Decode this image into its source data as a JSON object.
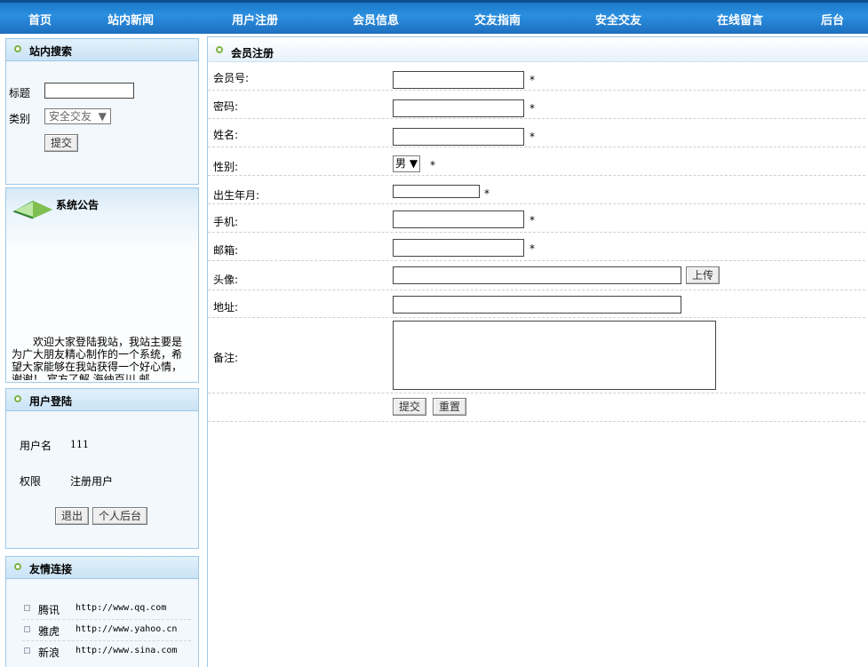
{
  "nav": [
    "首页",
    "站内新闻",
    "用户注册",
    "会员信息",
    "交友指南",
    "安全交友",
    "在线留言",
    "后台"
  ],
  "search": {
    "title": "站内搜索",
    "title_label": "标题",
    "category_label": "类别",
    "category_selected": "安全交友",
    "submit": "提交"
  },
  "notice": {
    "title": "系统公告",
    "text": "欢迎大家登陆我站，我站主要是为广大朋友精心制作的一个系统，希望大家能够在我站获得一个好心情，谢谢！ 官方了解 海纳百川 邮"
  },
  "login": {
    "title": "用户登陆",
    "username_label": "用户名",
    "username_value": "111",
    "role_label": "权限",
    "role_value": "注册用户",
    "logout": "退出",
    "backend": "个人后台"
  },
  "links": {
    "title": "友情连接",
    "items": [
      {
        "name": "腾讯",
        "url": "http://www.qq.com"
      },
      {
        "name": "雅虎",
        "url": "http://www.yahoo.cn"
      },
      {
        "name": "新浪",
        "url": "http://www.sina.com"
      }
    ]
  },
  "form": {
    "title": "会员注册",
    "fields": {
      "member_id": "会员号:",
      "password": "密码:",
      "name": "姓名:",
      "gender": "性别:",
      "birth": "出生年月:",
      "phone": "手机:",
      "email": "邮箱:",
      "avatar": "头像:",
      "address": "地址:",
      "remark": "备注:"
    },
    "required_mark": "*",
    "gender_selected": "男",
    "upload": "上传",
    "submit": "提交",
    "reset": "重置"
  }
}
